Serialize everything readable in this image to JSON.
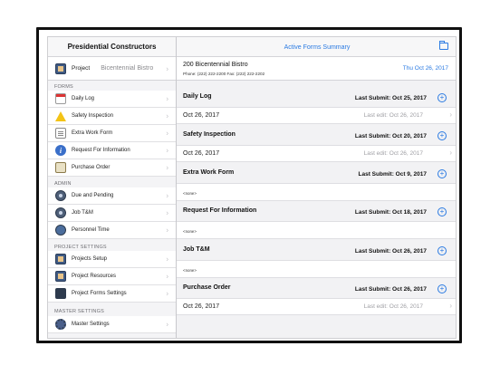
{
  "sidebar": {
    "title": "Presidential Constructors",
    "project": {
      "label": "Project",
      "value": "Bicentennial Bistro"
    },
    "sections": {
      "forms": "FORMS",
      "admin": "ADMIN",
      "project_settings": "PROJECT SETTINGS",
      "master_settings": "MASTER SETTINGS"
    },
    "forms_items": [
      {
        "label": "Daily Log",
        "icon": "calendar-icon"
      },
      {
        "label": "Safety Inspection",
        "icon": "warning-icon"
      },
      {
        "label": "Extra Work Form",
        "icon": "form-icon"
      },
      {
        "label": "Request For Information",
        "icon": "info-icon"
      },
      {
        "label": "Purchase Order",
        "icon": "purchase-order-icon"
      }
    ],
    "admin_items": [
      {
        "label": "Due and Pending",
        "icon": "badge-icon"
      },
      {
        "label": "Job T&M",
        "icon": "badge-icon"
      },
      {
        "label": "Personnel Time",
        "icon": "clock-icon"
      }
    ],
    "project_settings_items": [
      {
        "label": "Projects Setup",
        "icon": "book-icon"
      },
      {
        "label": "Project Resources",
        "icon": "resources-icon"
      },
      {
        "label": "Project Forms Settings",
        "icon": "phone-icon"
      }
    ],
    "master_settings_items": [
      {
        "label": "Master Settings",
        "icon": "gear-icon"
      }
    ]
  },
  "main": {
    "title": "Active Forms Summary",
    "project_name": "200 Bicentennial Bistro",
    "phone_line": "Phone: (222) 222-2200 Fax: (222) 222-2202",
    "date": "Thu Oct 26, 2017",
    "forms": [
      {
        "name": "Daily Log",
        "last_submit": "Last Submit: Oct 25, 2017",
        "entry": "Oct 26, 2017",
        "last_edit": "Last edit: Oct 26, 2017"
      },
      {
        "name": "Safety Inspection",
        "last_submit": "Last Submit: Oct 20, 2017",
        "entry": "Oct 26, 2017",
        "last_edit": "Last edit: Oct 26, 2017"
      },
      {
        "name": "Extra Work Form",
        "last_submit": "Last Submit: Oct 9, 2017",
        "none": "<none>"
      },
      {
        "name": "Request For Information",
        "last_submit": "Last Submit: Oct 18, 2017",
        "none": "<none>"
      },
      {
        "name": "Job T&M",
        "last_submit": "Last Submit: Oct 26, 2017",
        "none": "<none>"
      },
      {
        "name": "Purchase Order",
        "last_submit": "Last Submit: Oct 26, 2017",
        "entry": "Oct 26, 2017",
        "last_edit": "Last edit: Oct 26, 2017"
      }
    ]
  },
  "colors": {
    "accent": "#2a7ae2"
  }
}
